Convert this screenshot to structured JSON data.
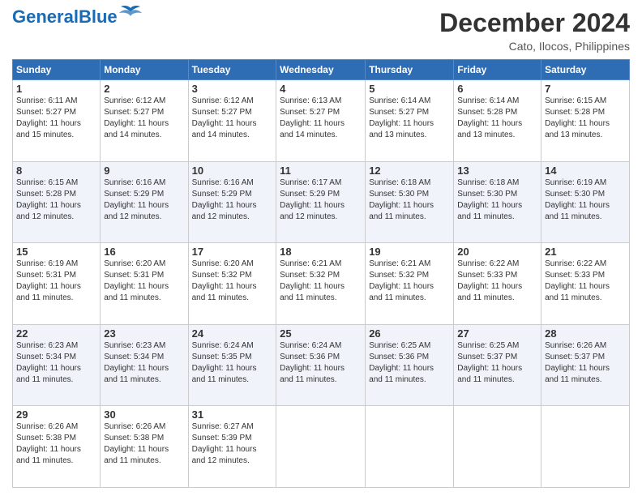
{
  "header": {
    "logo_general": "General",
    "logo_blue": "Blue",
    "month_title": "December 2024",
    "location": "Cato, Ilocos, Philippines"
  },
  "weekdays": [
    "Sunday",
    "Monday",
    "Tuesday",
    "Wednesday",
    "Thursday",
    "Friday",
    "Saturday"
  ],
  "weeks": [
    [
      {
        "day": "1",
        "sunrise": "6:11 AM",
        "sunset": "5:27 PM",
        "daylight": "11 hours and 15 minutes."
      },
      {
        "day": "2",
        "sunrise": "6:12 AM",
        "sunset": "5:27 PM",
        "daylight": "11 hours and 14 minutes."
      },
      {
        "day": "3",
        "sunrise": "6:12 AM",
        "sunset": "5:27 PM",
        "daylight": "11 hours and 14 minutes."
      },
      {
        "day": "4",
        "sunrise": "6:13 AM",
        "sunset": "5:27 PM",
        "daylight": "11 hours and 14 minutes."
      },
      {
        "day": "5",
        "sunrise": "6:14 AM",
        "sunset": "5:27 PM",
        "daylight": "11 hours and 13 minutes."
      },
      {
        "day": "6",
        "sunrise": "6:14 AM",
        "sunset": "5:28 PM",
        "daylight": "11 hours and 13 minutes."
      },
      {
        "day": "7",
        "sunrise": "6:15 AM",
        "sunset": "5:28 PM",
        "daylight": "11 hours and 13 minutes."
      }
    ],
    [
      {
        "day": "8",
        "sunrise": "6:15 AM",
        "sunset": "5:28 PM",
        "daylight": "11 hours and 12 minutes."
      },
      {
        "day": "9",
        "sunrise": "6:16 AM",
        "sunset": "5:29 PM",
        "daylight": "11 hours and 12 minutes."
      },
      {
        "day": "10",
        "sunrise": "6:16 AM",
        "sunset": "5:29 PM",
        "daylight": "11 hours and 12 minutes."
      },
      {
        "day": "11",
        "sunrise": "6:17 AM",
        "sunset": "5:29 PM",
        "daylight": "11 hours and 12 minutes."
      },
      {
        "day": "12",
        "sunrise": "6:18 AM",
        "sunset": "5:30 PM",
        "daylight": "11 hours and 11 minutes."
      },
      {
        "day": "13",
        "sunrise": "6:18 AM",
        "sunset": "5:30 PM",
        "daylight": "11 hours and 11 minutes."
      },
      {
        "day": "14",
        "sunrise": "6:19 AM",
        "sunset": "5:30 PM",
        "daylight": "11 hours and 11 minutes."
      }
    ],
    [
      {
        "day": "15",
        "sunrise": "6:19 AM",
        "sunset": "5:31 PM",
        "daylight": "11 hours and 11 minutes."
      },
      {
        "day": "16",
        "sunrise": "6:20 AM",
        "sunset": "5:31 PM",
        "daylight": "11 hours and 11 minutes."
      },
      {
        "day": "17",
        "sunrise": "6:20 AM",
        "sunset": "5:32 PM",
        "daylight": "11 hours and 11 minutes."
      },
      {
        "day": "18",
        "sunrise": "6:21 AM",
        "sunset": "5:32 PM",
        "daylight": "11 hours and 11 minutes."
      },
      {
        "day": "19",
        "sunrise": "6:21 AM",
        "sunset": "5:32 PM",
        "daylight": "11 hours and 11 minutes."
      },
      {
        "day": "20",
        "sunrise": "6:22 AM",
        "sunset": "5:33 PM",
        "daylight": "11 hours and 11 minutes."
      },
      {
        "day": "21",
        "sunrise": "6:22 AM",
        "sunset": "5:33 PM",
        "daylight": "11 hours and 11 minutes."
      }
    ],
    [
      {
        "day": "22",
        "sunrise": "6:23 AM",
        "sunset": "5:34 PM",
        "daylight": "11 hours and 11 minutes."
      },
      {
        "day": "23",
        "sunrise": "6:23 AM",
        "sunset": "5:34 PM",
        "daylight": "11 hours and 11 minutes."
      },
      {
        "day": "24",
        "sunrise": "6:24 AM",
        "sunset": "5:35 PM",
        "daylight": "11 hours and 11 minutes."
      },
      {
        "day": "25",
        "sunrise": "6:24 AM",
        "sunset": "5:36 PM",
        "daylight": "11 hours and 11 minutes."
      },
      {
        "day": "26",
        "sunrise": "6:25 AM",
        "sunset": "5:36 PM",
        "daylight": "11 hours and 11 minutes."
      },
      {
        "day": "27",
        "sunrise": "6:25 AM",
        "sunset": "5:37 PM",
        "daylight": "11 hours and 11 minutes."
      },
      {
        "day": "28",
        "sunrise": "6:26 AM",
        "sunset": "5:37 PM",
        "daylight": "11 hours and 11 minutes."
      }
    ],
    [
      {
        "day": "29",
        "sunrise": "6:26 AM",
        "sunset": "5:38 PM",
        "daylight": "11 hours and 11 minutes."
      },
      {
        "day": "30",
        "sunrise": "6:26 AM",
        "sunset": "5:38 PM",
        "daylight": "11 hours and 11 minutes."
      },
      {
        "day": "31",
        "sunrise": "6:27 AM",
        "sunset": "5:39 PM",
        "daylight": "11 hours and 12 minutes."
      },
      null,
      null,
      null,
      null
    ]
  ]
}
